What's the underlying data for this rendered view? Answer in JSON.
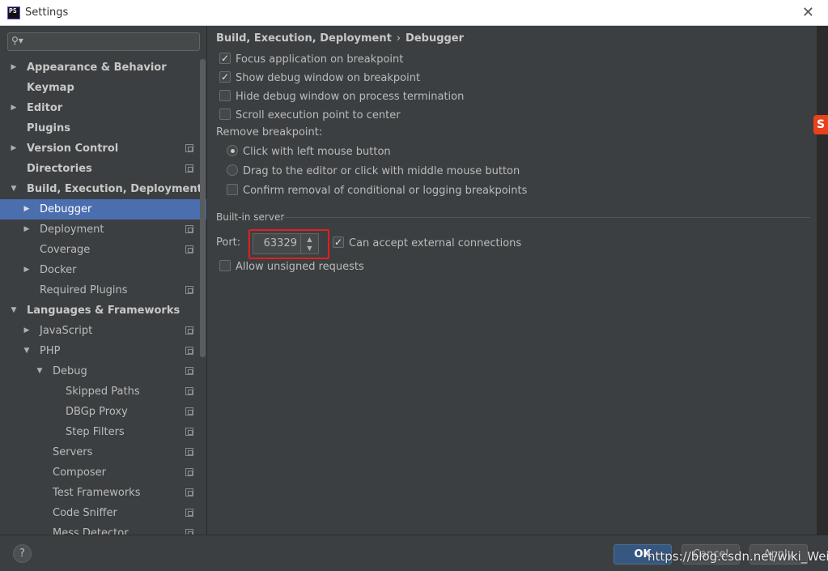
{
  "window": {
    "title": "Settings",
    "app_icon": "PS"
  },
  "search": {
    "placeholder": ""
  },
  "sidebar": {
    "items": [
      {
        "label": "Appearance & Behavior",
        "bold": true,
        "level": 0,
        "arrow": "right",
        "proj": false
      },
      {
        "label": "Keymap",
        "bold": true,
        "level": 0,
        "arrow": "",
        "proj": false
      },
      {
        "label": "Editor",
        "bold": true,
        "level": 0,
        "arrow": "right",
        "proj": false
      },
      {
        "label": "Plugins",
        "bold": true,
        "level": 0,
        "arrow": "",
        "proj": false
      },
      {
        "label": "Version Control",
        "bold": true,
        "level": 0,
        "arrow": "right",
        "proj": true
      },
      {
        "label": "Directories",
        "bold": true,
        "level": 0,
        "arrow": "",
        "proj": true
      },
      {
        "label": "Build, Execution, Deployment",
        "bold": true,
        "level": 0,
        "arrow": "down",
        "proj": false
      },
      {
        "label": "Debugger",
        "bold": false,
        "level": 1,
        "arrow": "right",
        "proj": false,
        "selected": true
      },
      {
        "label": "Deployment",
        "bold": false,
        "level": 1,
        "arrow": "right",
        "proj": true
      },
      {
        "label": "Coverage",
        "bold": false,
        "level": 1,
        "arrow": "",
        "proj": true
      },
      {
        "label": "Docker",
        "bold": false,
        "level": 1,
        "arrow": "right",
        "proj": false
      },
      {
        "label": "Required Plugins",
        "bold": false,
        "level": 1,
        "arrow": "",
        "proj": true
      },
      {
        "label": "Languages & Frameworks",
        "bold": true,
        "level": 0,
        "arrow": "down",
        "proj": false
      },
      {
        "label": "JavaScript",
        "bold": false,
        "level": 1,
        "arrow": "right",
        "proj": true
      },
      {
        "label": "PHP",
        "bold": false,
        "level": 1,
        "arrow": "down",
        "proj": true
      },
      {
        "label": "Debug",
        "bold": false,
        "level": 2,
        "arrow": "down",
        "proj": true
      },
      {
        "label": "Skipped Paths",
        "bold": false,
        "level": 3,
        "arrow": "",
        "proj": true
      },
      {
        "label": "DBGp Proxy",
        "bold": false,
        "level": 3,
        "arrow": "",
        "proj": true
      },
      {
        "label": "Step Filters",
        "bold": false,
        "level": 3,
        "arrow": "",
        "proj": true
      },
      {
        "label": "Servers",
        "bold": false,
        "level": 2,
        "arrow": "",
        "proj": true
      },
      {
        "label": "Composer",
        "bold": false,
        "level": 2,
        "arrow": "",
        "proj": true
      },
      {
        "label": "Test Frameworks",
        "bold": false,
        "level": 2,
        "arrow": "",
        "proj": true
      },
      {
        "label": "Code Sniffer",
        "bold": false,
        "level": 2,
        "arrow": "",
        "proj": true
      },
      {
        "label": "Mess Detector",
        "bold": false,
        "level": 2,
        "arrow": "",
        "proj": true
      }
    ]
  },
  "breadcrumb": {
    "parent": "Build, Execution, Deployment",
    "separator": "›",
    "current": "Debugger"
  },
  "options": {
    "focus_app": {
      "label": "Focus application on breakpoint",
      "checked": true
    },
    "show_debug": {
      "label": "Show debug window on breakpoint",
      "checked": true
    },
    "hide_debug": {
      "label": "Hide debug window on process termination",
      "checked": false
    },
    "scroll_exec": {
      "label": "Scroll execution point to center",
      "checked": false
    },
    "remove_bp_label": "Remove breakpoint:",
    "click_left": {
      "label": "Click with left mouse button",
      "checked": true
    },
    "drag_editor": {
      "label": "Drag to the editor or click with middle mouse button",
      "checked": false
    },
    "confirm_removal": {
      "label": "Confirm removal of conditional or logging breakpoints",
      "checked": false
    }
  },
  "builtin_server": {
    "section_label": "Built-in server",
    "port_label": "Port:",
    "port_value": "63329",
    "accept_external": {
      "label": "Can accept external connections",
      "checked": true
    },
    "allow_unsigned": {
      "label": "Allow unsigned requests",
      "checked": false
    }
  },
  "footer": {
    "help": "?",
    "ok": "OK",
    "cancel": "Cancel",
    "apply": "Apply",
    "watermark": "https://blog.csdn.net/wiki_Wei"
  },
  "colors": {
    "selection": "#4b6eaf",
    "highlight_box": "#e02020",
    "ok_button": "#365880"
  }
}
